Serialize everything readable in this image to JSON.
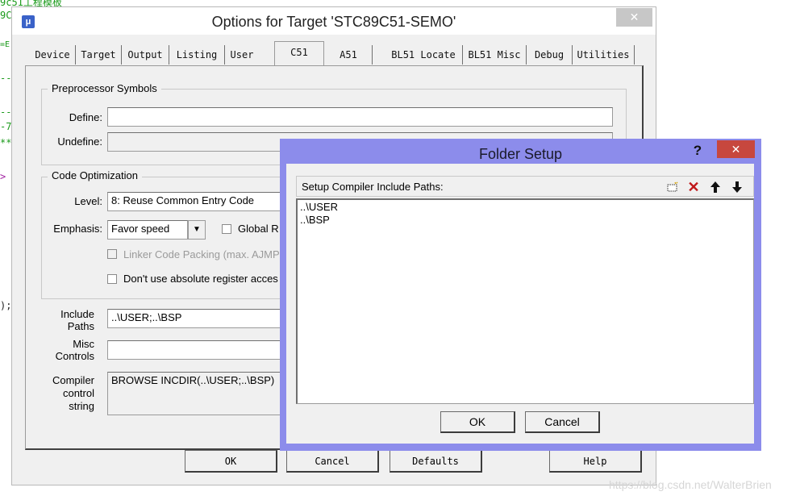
{
  "background_code": {
    "line1": "9c51工程模板",
    "line2": "9C",
    "line3": "=E",
    "line4": "--",
    "line5": "--",
    "line6": "-7",
    "line7": "**",
    "line8": ">",
    "line9": ");"
  },
  "options_window": {
    "title": "Options for Target 'STC89C51-SEMO'",
    "close_glyph": "✕",
    "tabs": [
      "Device",
      "Target",
      "Output",
      "Listing",
      "User",
      "C51",
      "A51",
      "BL51 Locate",
      "BL51 Misc",
      "Debug",
      "Utilities"
    ],
    "active_tab": "C51",
    "preprocessor": {
      "group_label": "Preprocessor Symbols",
      "define_label": "Define:",
      "define_value": "",
      "undefine_label": "Undefine:",
      "undefine_value": ""
    },
    "optimization": {
      "group_label": "Code Optimization",
      "level_label": "Level:",
      "level_value": "8: Reuse Common Entry Code",
      "emphasis_label": "Emphasis:",
      "emphasis_value": "Favor speed",
      "global_reg_label": "Global R",
      "linker_packing_label": "Linker Code Packing (max. AJMP",
      "absolute_reg_label": "Don't use absolute register acces"
    },
    "include_paths_label_1": "Include",
    "include_paths_label_2": "Paths",
    "include_paths_value": "..\\USER;..\\BSP",
    "misc_controls_label_1": "Misc",
    "misc_controls_label_2": "Controls",
    "misc_controls_value": "",
    "compiler_string_label_1": "Compiler",
    "compiler_string_label_2": "control",
    "compiler_string_label_3": "string",
    "compiler_string_value": "BROWSE INCDIR(..\\USER;..\\BSP)",
    "buttons": {
      "ok": "OK",
      "cancel": "Cancel",
      "defaults": "Defaults",
      "help": "Help"
    }
  },
  "folder_setup": {
    "title": "Folder Setup",
    "help_glyph": "?",
    "close_glyph": "✕",
    "list_header": "Setup Compiler Include Paths:",
    "paths": [
      "..\\USER",
      "..\\BSP"
    ],
    "ok": "OK",
    "cancel": "Cancel"
  },
  "watermark": "https://blog.csdn.net/WalterBrien",
  "colors": {
    "folder_frame": "#8c8ceb",
    "close_red": "#c7473e",
    "code_green": "#1a9a1a"
  }
}
